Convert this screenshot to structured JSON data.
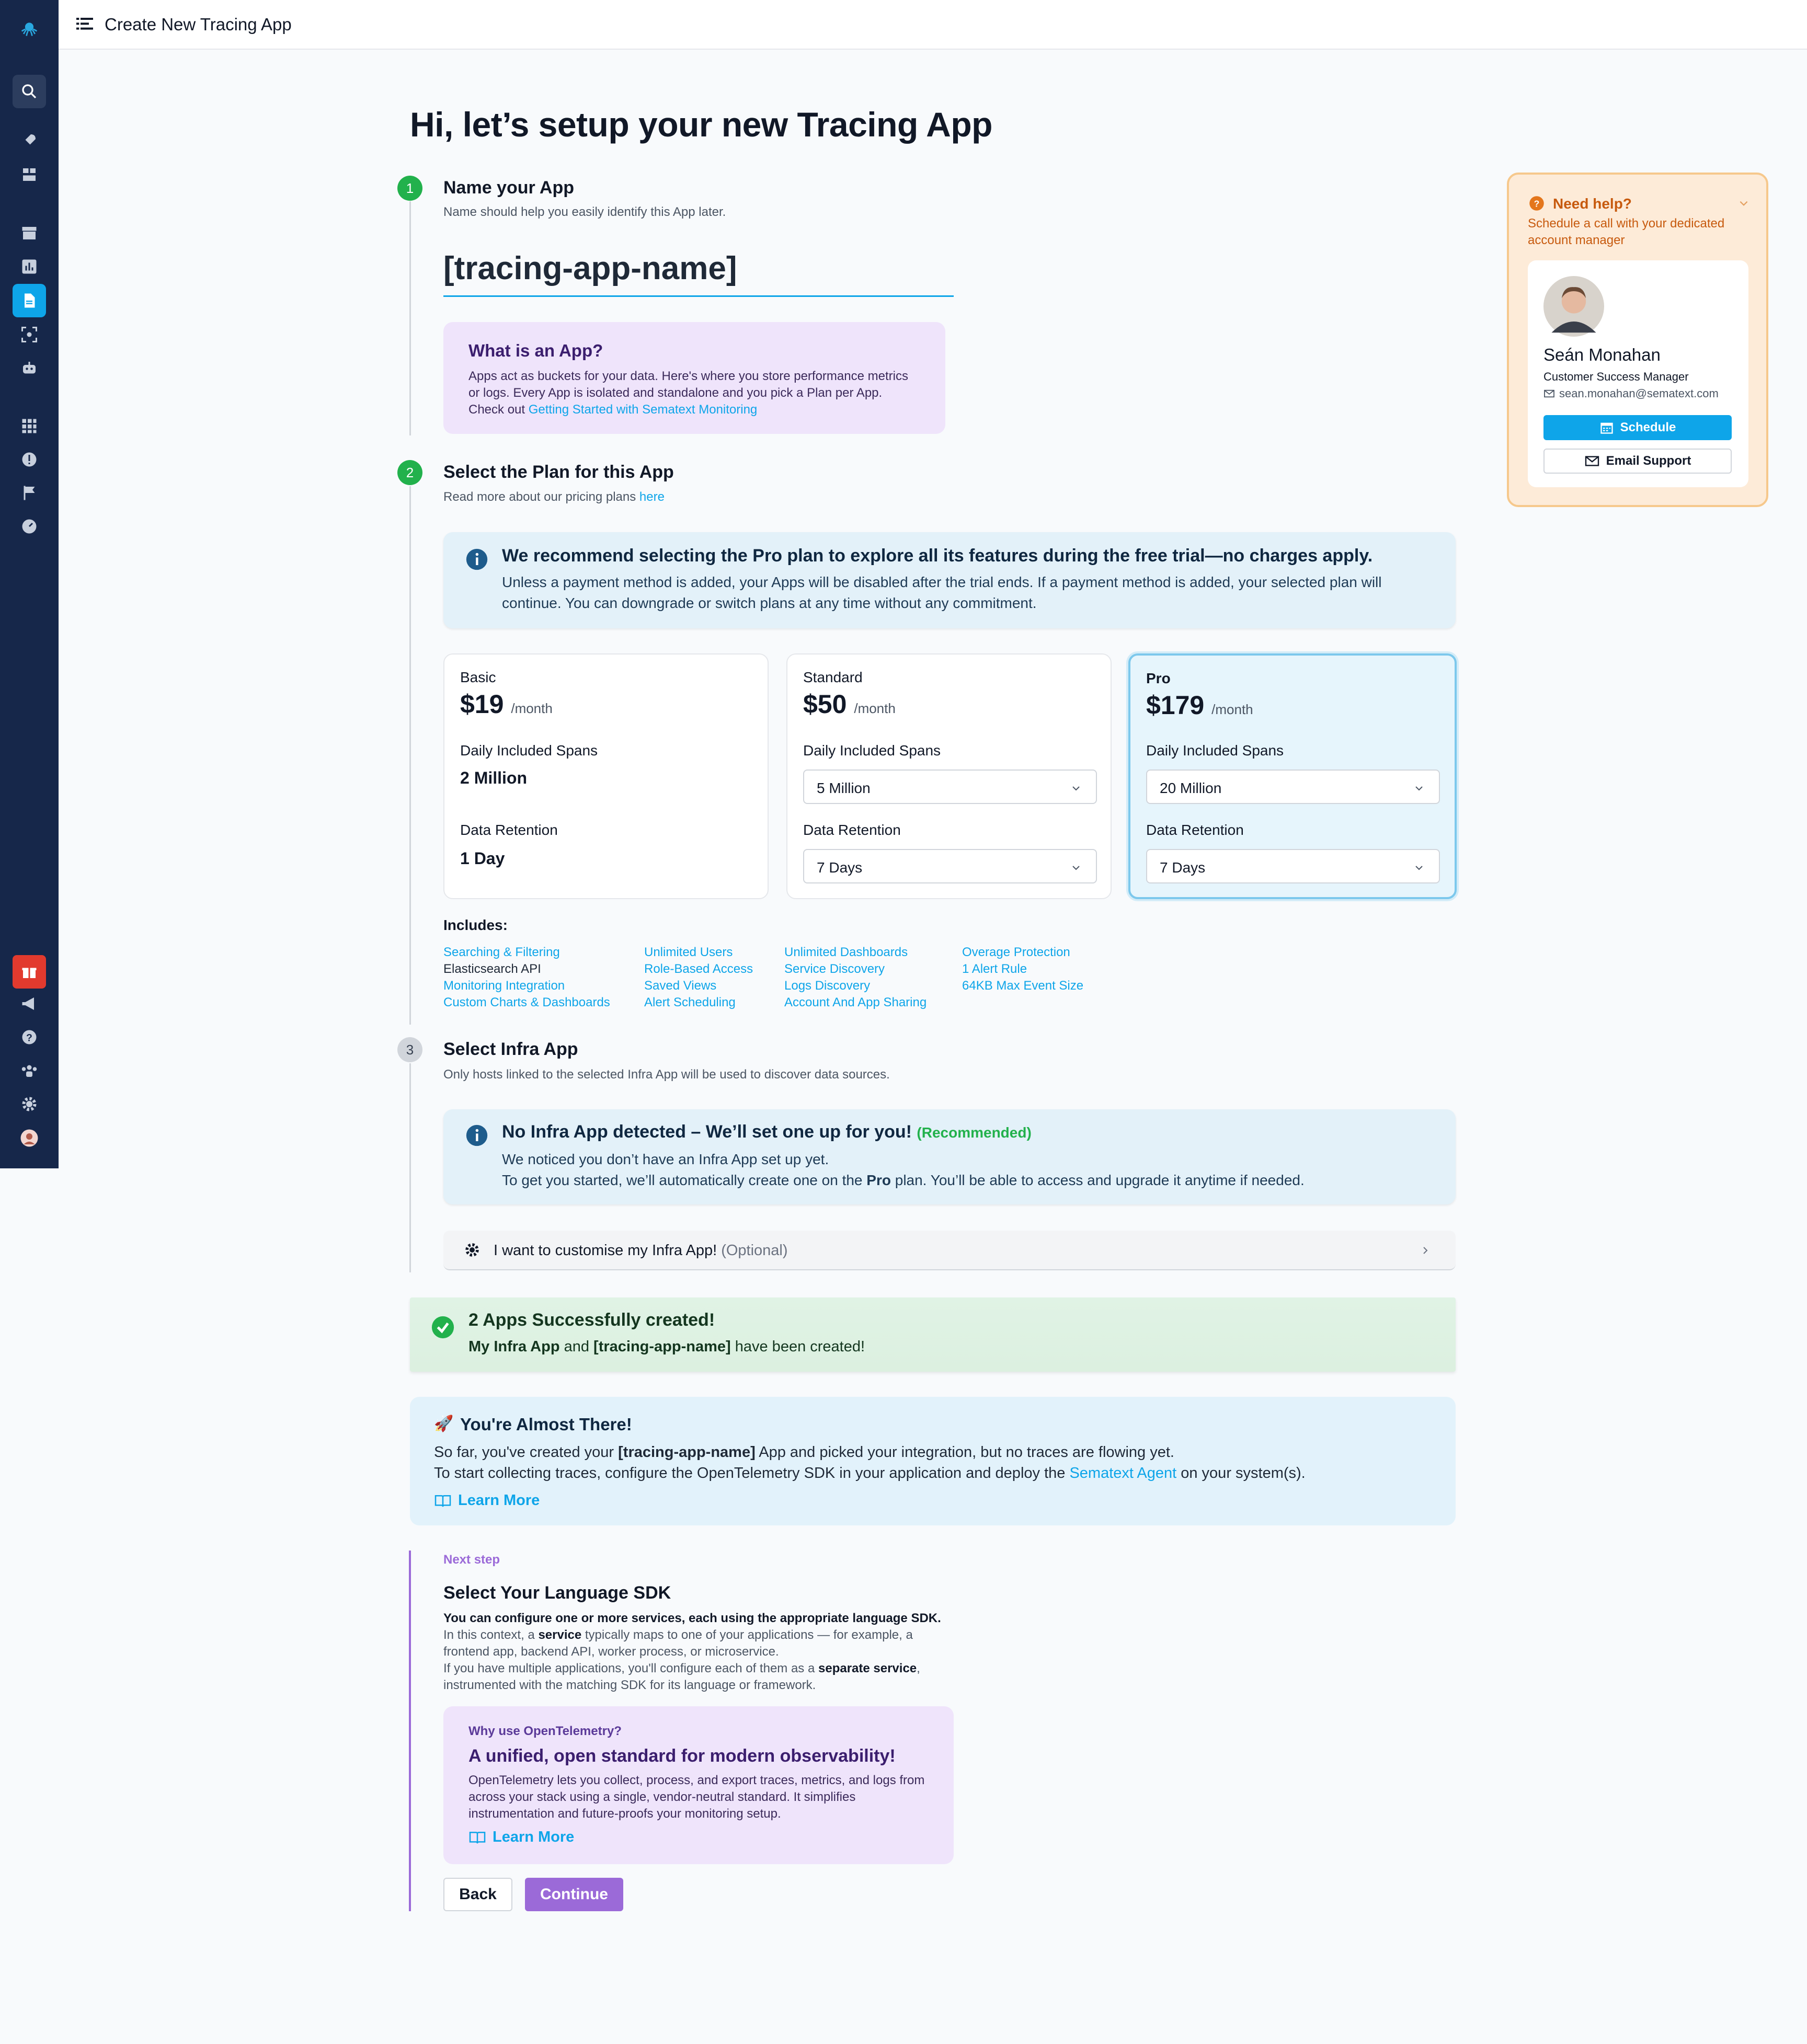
{
  "topbar": {
    "title": "Create New Tracing App"
  },
  "page": {
    "heading": "Hi, let’s setup your new Tracing App"
  },
  "step1": {
    "number": "1",
    "title": "Name your App",
    "subtitle": "Name should help you easily identify this App later.",
    "app_name_value": "[tracing-app-name]",
    "info_title": "What is an App?",
    "info_text": "Apps act as buckets for your data. Here's where you store performance metrics or logs. Every App is isolated and standalone and you pick a Plan per App. Check out ",
    "info_link": "Getting Started with Sematext Monitoring"
  },
  "step2": {
    "number": "2",
    "title": "Select the Plan for this App",
    "subtitle": "Read more about our pricing plans ",
    "subtitle_link": "here",
    "recommend_title": "We recommend selecting the Pro plan to explore all its features during the free trial—no charges apply.",
    "recommend_text": "Unless a payment method is added, your Apps will be disabled after the trial ends. If a payment method is added, your selected plan will continue. You can downgrade or switch plans at any time without any commitment.",
    "plans": [
      {
        "name": "Basic",
        "price": "$19",
        "per": "/month",
        "spans_label": "Daily Included Spans",
        "spans": "2 Million",
        "retention_label": "Data Retention",
        "retention": "1 Day"
      },
      {
        "name": "Standard",
        "price": "$50",
        "per": "/month",
        "spans_label": "Daily Included Spans",
        "spans": "5 Million",
        "retention_label": "Data Retention",
        "retention": "7 Days"
      },
      {
        "name": "Pro",
        "price": "$179",
        "per": "/month",
        "spans_label": "Daily Included Spans",
        "spans": "20 Million",
        "retention_label": "Data Retention",
        "retention": "7 Days"
      }
    ],
    "includes_label": "Includes:",
    "includes": [
      [
        "Searching & Filtering",
        "Elasticsearch API",
        "Monitoring Integration",
        "Custom Charts & Dashboards"
      ],
      [
        "Unlimited Users",
        "Role-Based Access",
        "Saved Views",
        "Alert Scheduling"
      ],
      [
        "Unlimited Dashboards",
        "Service Discovery",
        "Logs Discovery",
        "Account And App Sharing"
      ],
      [
        "Overage Protection",
        "1 Alert Rule",
        "64KB Max Event Size"
      ]
    ]
  },
  "step3": {
    "number": "3",
    "title": "Select Infra App",
    "subtitle": "Only hosts linked to the selected Infra App will be used to discover data sources.",
    "notice_title": "No Infra App detected – We’ll set one up for you!",
    "notice_tag": "(Recommended)",
    "notice_line1": "We noticed you don’t have an Infra App set up yet.",
    "notice_line2a": "To get you started, we’ll automatically create one on the ",
    "notice_line2b": "Pro",
    "notice_line2c": " plan. You’ll be able to access and upgrade it anytime if needed.",
    "customise_label": "I want to customise my Infra App!",
    "customise_optional": "(Optional)"
  },
  "success": {
    "title": "2 Apps Successfully created!",
    "text_a": "My Infra App",
    "text_b": " and ",
    "text_c": "[tracing-app-name]",
    "text_d": " have been created!"
  },
  "almost": {
    "emoji": "🚀",
    "title": "You're Almost There!",
    "line1a": "So far, you've created your ",
    "line1b": "[tracing-app-name]",
    "line1c": " App and picked your integration, but no traces are flowing yet.",
    "line2a": "To start collecting traces, configure the OpenTelemetry SDK in your application and deploy the ",
    "line2b": "Sematext Agent",
    "line2c": " on your system(s).",
    "learn_more": "Learn More"
  },
  "next": {
    "label": "Next step",
    "title": "Select Your Language SDK",
    "bold_line": "You can configure one or more services, each using the appropriate language SDK.",
    "p1a": "In this context, a ",
    "p1b": "service",
    "p1c": " typically maps to one of your applications — for example, a frontend app, backend API, worker process, or microservice.",
    "p2a": "If you have multiple applications, you'll configure each of them as a ",
    "p2b": "separate service",
    "p2c": ", instrumented with the matching SDK for its language or framework.",
    "otel_small": "Why use OpenTelemetry?",
    "otel_title": "A unified, open standard for modern observability!",
    "otel_text": "OpenTelemetry lets you collect, process, and export traces, metrics, and logs from across your stack using a single, vendor-neutral standard. It simplifies instrumentation and future-proofs your monitoring setup.",
    "learn_more": "Learn More",
    "back": "Back",
    "continue": "Continue"
  },
  "help": {
    "title": "Need help?",
    "subtitle": "Schedule a call with your dedicated account manager",
    "name": "Seán Monahan",
    "role": "Customer Success Manager",
    "email": "sean.monahan@sematext.com",
    "schedule": "Schedule",
    "email_support": "Email Support"
  },
  "colors": {
    "accent": "#0ea5e9",
    "sidebar": "#16274a",
    "success": "#22b14c",
    "purple": "#9b6ad8"
  }
}
